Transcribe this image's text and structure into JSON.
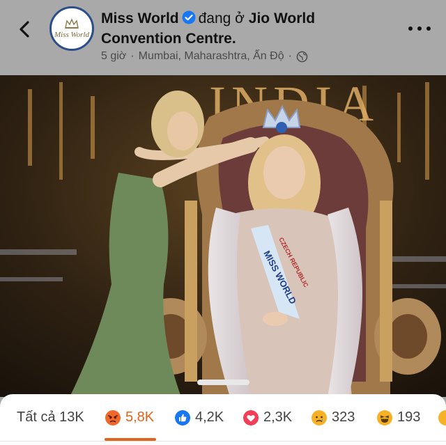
{
  "post": {
    "page_name": "Miss World",
    "location_prefix": "đang ở",
    "location_name_line1": "Jio World",
    "location_name_line2": "Convention Centre.",
    "time": "5 giờ",
    "separator": "·",
    "place": "Mumbai, Maharashtra, Ấn Độ",
    "privacy_icon": "globe-icon",
    "verified_icon": "verified-badge-icon",
    "avatar_logo_text": "Miss World"
  },
  "nav": {
    "back_icon": "chevron-left-icon",
    "more_icon": "more-dots-icon"
  },
  "photo": {
    "backdrop_text": "INDIA",
    "sash_text": "MISS WORLD",
    "sash_subtext": "CZECH REPUBLIC"
  },
  "reactions": {
    "all_label": "Tất cả 13K",
    "items": [
      {
        "icon": "angry-emoji-icon",
        "count": "5,8K"
      },
      {
        "icon": "like-thumb-icon",
        "count": "4,2K"
      },
      {
        "icon": "love-heart-icon",
        "count": "2,3K"
      },
      {
        "icon": "sad-emoji-icon",
        "count": "323"
      },
      {
        "icon": "haha-emoji-icon",
        "count": "193"
      }
    ]
  },
  "colors": {
    "header_bg": "#a9a9a9",
    "verified_blue": "#1877f2",
    "angry_orange": "#e0641c",
    "like_blue": "#1877f2",
    "love_red": "#f33e58",
    "emoji_yellow": "#f7b125"
  }
}
